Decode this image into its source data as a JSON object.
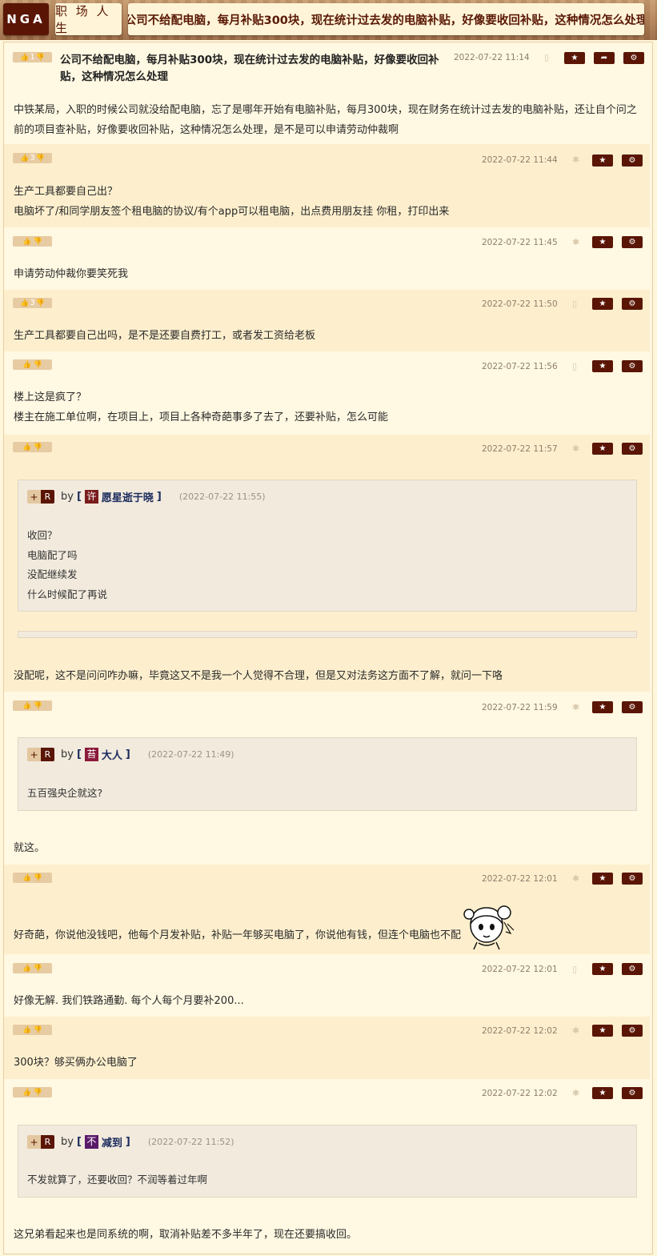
{
  "header": {
    "logo": "NGA",
    "forum": "职 场 人 生",
    "topic": "公司不给配电脑，每月补贴300块，现在统计过去发的电脑补贴，好像要收回补贴，这种情况怎么处理"
  },
  "icons": {
    "thumbs_up": "thumbs-up-icon",
    "thumbs_down": "thumbs-down-icon",
    "star": "star-icon",
    "share": "share-icon",
    "gear": "gear-icon",
    "mobile": "mobile-icon",
    "android": "android-icon"
  },
  "colors": {
    "brand": "#5a1505",
    "vote_bg": "#e7cba3",
    "row_light": "#fff8e2",
    "row_dark": "#fdefcd",
    "quote_bg": "#f1eadd"
  },
  "posts": [
    {
      "votes": "1",
      "time": "2022-07-22 11:14",
      "title": "公司不给配电脑，每月补贴300块，现在统计过去发的电脑补贴，好像要收回补贴，这种情况怎么处理",
      "lines": [
        "中铁某局，入职的时候公司就没给配电脑，忘了是哪年开始有电脑补贴，每月300块，现在财务在统计过去发的电脑补贴，还让自个问之前的项目查补贴，好像要收回补贴，这种情况怎么处理，是不是可以申请劳动仲裁啊"
      ]
    },
    {
      "votes": "3",
      "time": "2022-07-22 11:44",
      "lines": [
        "生产工具都要自己出？",
        "电脑坏了/和同学朋友签个租电脑的协议/有个app可以租电脑，出点费用朋友挂 你租，打印出来"
      ]
    },
    {
      "votes": "",
      "time": "2022-07-22 11:45",
      "lines": [
        "申请劳动仲裁你要笑死我"
      ]
    },
    {
      "votes": "3",
      "time": "2022-07-22 11:50",
      "lines": [
        "生产工具都要自己出吗，是不是还要自费打工，或者发工资给老板"
      ]
    },
    {
      "votes": "",
      "time": "2022-07-22 11:56",
      "lines": [
        "楼上这是疯了？",
        "楼主在施工单位啊，在项目上，项目上各种奇葩事多了去了，还要补贴，怎么可能"
      ]
    },
    {
      "votes": "",
      "time": "2022-07-22 11:57",
      "quote": {
        "plus": "+",
        "r": "R",
        "by": "by",
        "avatar": "许",
        "user": "愿星逝于晓",
        "date": "(2022-07-22 11:55)",
        "lines": [
          "收回？",
          "电脑配了吗",
          "没配继续发",
          "什么时候配了再说"
        ]
      },
      "lines": [
        "没配呢，这不是问问咋办嘛，毕竟这又不是我一个人觉得不合理，但是又对法务这方面不了解，就问一下咯"
      ]
    },
    {
      "votes": "",
      "time": "2022-07-22 11:59",
      "quote": {
        "plus": "+",
        "r": "R",
        "by": "by",
        "avatar": "苔",
        "user": "大人",
        "date": "(2022-07-22 11:49)",
        "lines": [
          "五百强央企就这?"
        ]
      },
      "lines": [
        "就这。"
      ]
    },
    {
      "votes": "",
      "time": "2022-07-22 12:01",
      "lines": [
        "好奇葩，你说他没钱吧，他每个月发补贴，补贴一年够买电脑了，你说他有钱，但连个电脑也不配"
      ]
    },
    {
      "votes": "",
      "time": "2022-07-22 12:01",
      "lines": [
        "好像无解. 我们铁路通勤. 每个人每个月要补200..."
      ]
    },
    {
      "votes": "",
      "time": "2022-07-22 12:02",
      "lines": [
        "300块？够买俩办公电脑了"
      ]
    },
    {
      "votes": "",
      "time": "2022-07-22 12:02",
      "quote": {
        "plus": "+",
        "r": "R",
        "by": "by",
        "avatar": "不",
        "user": "减到",
        "date": "(2022-07-22 11:52)",
        "lines": [
          "不发就算了，还要收回？不润等着过年啊"
        ]
      },
      "lines": [
        "这兄弟看起来也是同系统的啊，取消补贴差不多半年了，现在还要搞收回。"
      ]
    }
  ]
}
